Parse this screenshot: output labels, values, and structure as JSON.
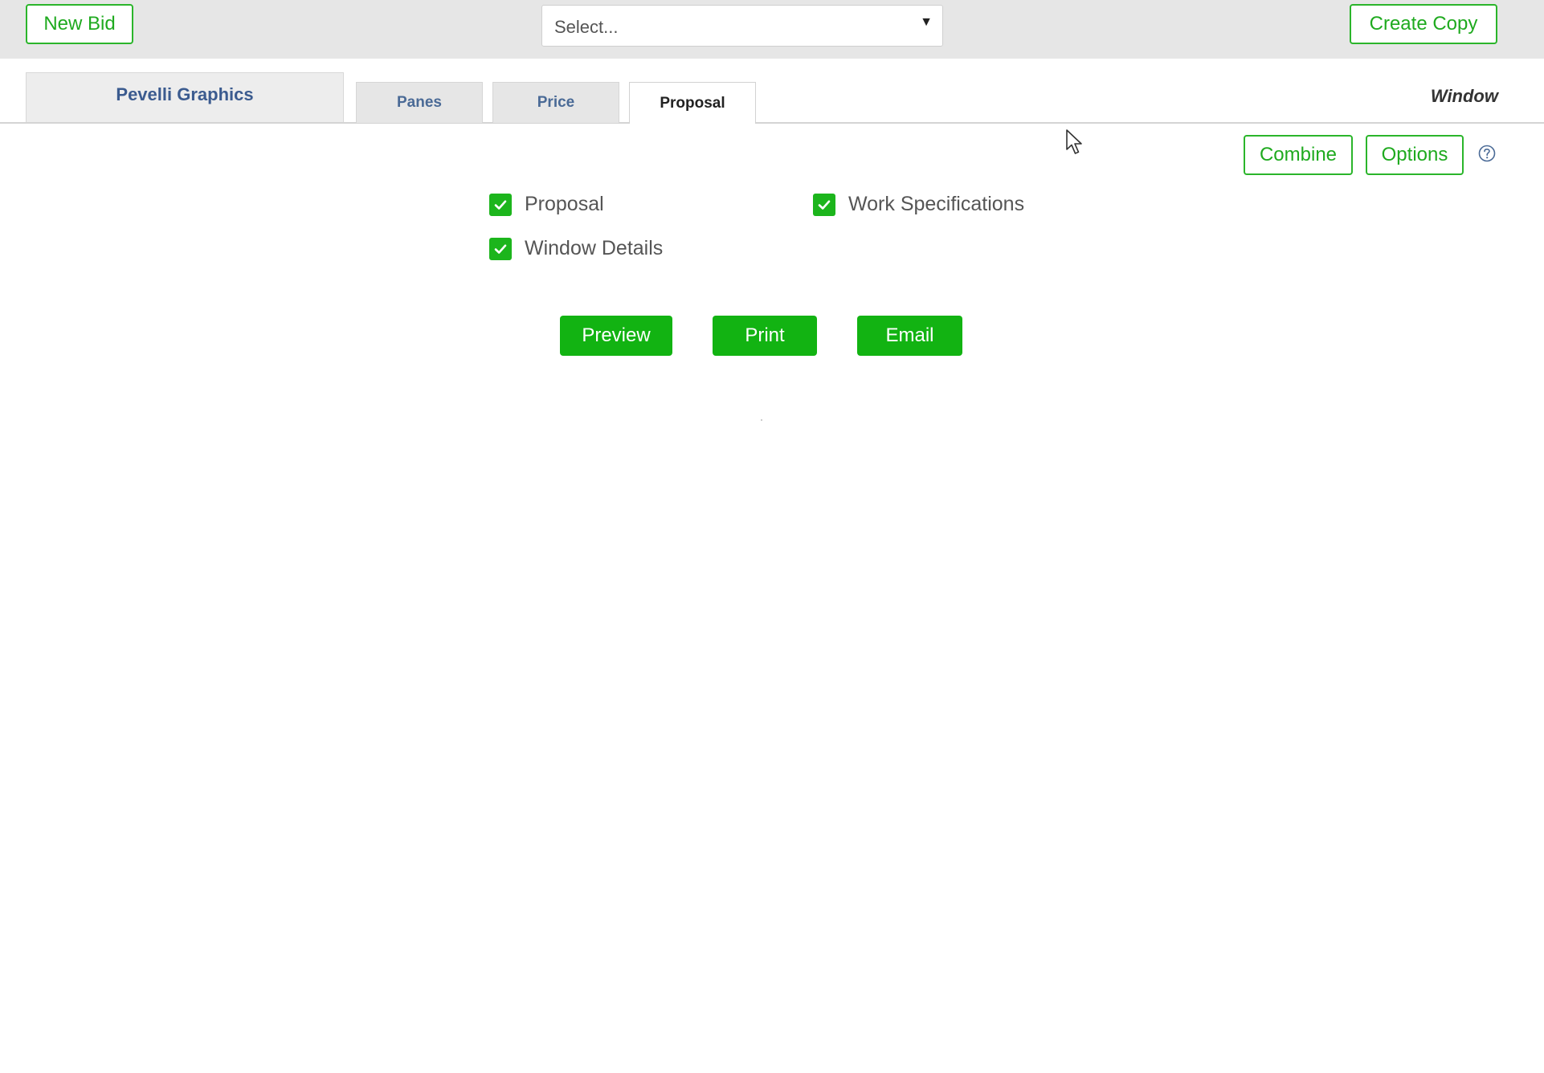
{
  "header": {
    "new_bid_label": "New Bid",
    "select_placeholder": "Select...",
    "select_arrow": "▼",
    "create_copy_label": "Create Copy"
  },
  "tabs": {
    "company": "Pevelli Graphics",
    "items": [
      {
        "label": "Panes",
        "active": false
      },
      {
        "label": "Price",
        "active": false
      },
      {
        "label": "Proposal",
        "active": true
      }
    ],
    "right_label": "Window"
  },
  "toolbar": {
    "combine_label": "Combine",
    "options_label": "Options",
    "help_icon": "question-circle-icon"
  },
  "documents": [
    {
      "label": "Proposal",
      "checked": true
    },
    {
      "label": "Work Specifications",
      "checked": true
    },
    {
      "label": "Window Details",
      "checked": true
    }
  ],
  "actions": {
    "preview_label": "Preview",
    "print_label": "Print",
    "email_label": "Email"
  },
  "colors": {
    "accent_green": "#12b312",
    "outline_green": "#2bb52b",
    "tab_text_blue": "#3b5b8f",
    "topbar_bg": "#e6e6e6"
  }
}
